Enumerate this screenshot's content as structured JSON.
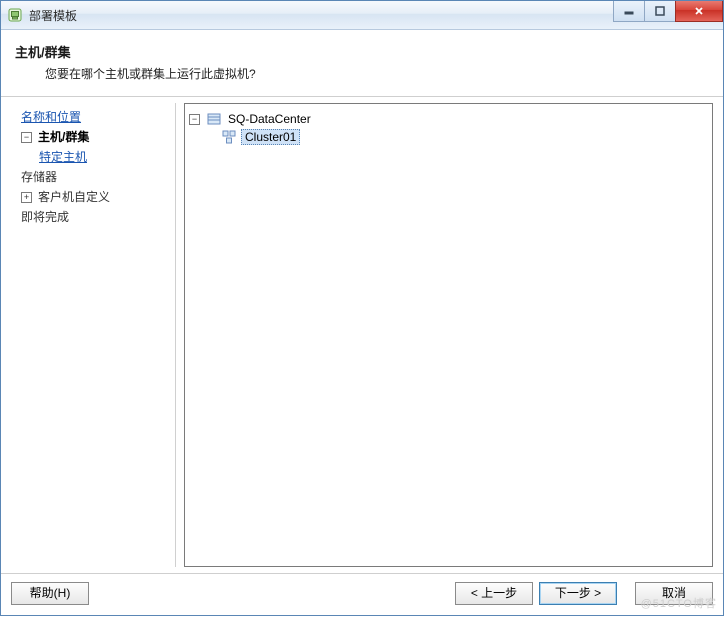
{
  "window": {
    "title": "部署模板"
  },
  "header": {
    "title": "主机/群集",
    "subtitle": "您要在哪个主机或群集上运行此虚拟机?"
  },
  "sidebar": {
    "items": [
      {
        "label": "名称和位置",
        "type": "link"
      },
      {
        "label": "主机/群集",
        "type": "bold-exp"
      },
      {
        "label": "特定主机",
        "type": "link-indent"
      },
      {
        "label": "存储器",
        "type": "plain"
      },
      {
        "label": "客户机自定义",
        "type": "plain-exp"
      },
      {
        "label": "即将完成",
        "type": "plain"
      }
    ]
  },
  "tree": {
    "root": {
      "label": "SQ-DataCenter",
      "icon": "datacenter"
    },
    "child": {
      "label": "Cluster01",
      "icon": "cluster",
      "selected": true
    }
  },
  "buttons": {
    "help": "帮助(H)",
    "back": "< 上一步",
    "next": "下一步 >",
    "cancel": "取消"
  },
  "watermark": "@51CTO博客"
}
